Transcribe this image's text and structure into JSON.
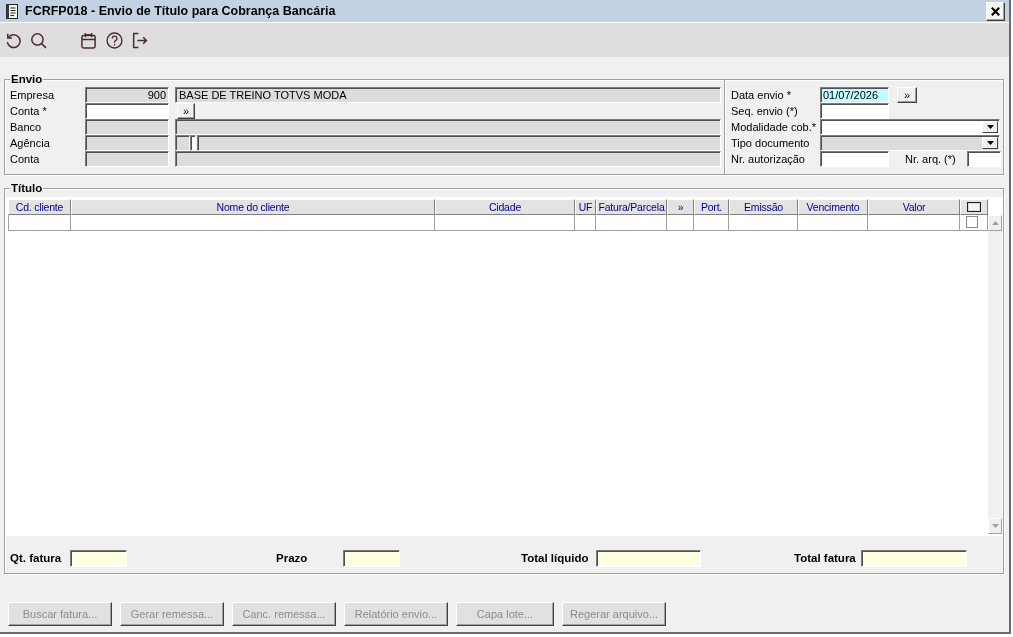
{
  "window": {
    "title": "FCRFP018 - Envio de Título para Cobrança Bancária"
  },
  "envio": {
    "title": "Envio",
    "left_rows": [
      {
        "label": "Empresa",
        "fields": [
          {
            "kind": "code",
            "value": "900",
            "disabled": true
          },
          {
            "kind": "name",
            "value": "BASE DE TREINO TOTVS MODA",
            "disabled": true
          }
        ]
      },
      {
        "label": "Conta *",
        "fields": [
          {
            "kind": "code",
            "disabled": false
          },
          {
            "kind": "lookup",
            "label": "»"
          }
        ]
      },
      {
        "label": "Banco",
        "fields": [
          {
            "kind": "code",
            "disabled": true
          },
          {
            "kind": "name",
            "disabled": true
          }
        ]
      },
      {
        "label": "Agência",
        "fields": [
          {
            "kind": "code",
            "disabled": true
          },
          {
            "kind": "digit",
            "disabled": true
          },
          {
            "kind": "mini",
            "disabled": false
          },
          {
            "kind": "name",
            "disabled": true
          }
        ]
      },
      {
        "label": "Conta",
        "fields": [
          {
            "kind": "code",
            "disabled": true
          },
          {
            "kind": "name",
            "disabled": true
          }
        ]
      }
    ],
    "right_rows": [
      {
        "label": "Data envio *",
        "field": {
          "kind": "date",
          "value": "01/07/2026",
          "disabled": false,
          "focused": true
        },
        "button": {
          "label": "»"
        }
      },
      {
        "label": "Seq. envio (*)",
        "field": {
          "kind": "short",
          "disabled": false,
          "focused": false
        }
      },
      {
        "label": "Modalidade cob.*",
        "field": {
          "kind": "combo",
          "disabled": false,
          "focused": false
        }
      },
      {
        "label": "Tipo documento",
        "field": {
          "kind": "combo",
          "disabled": true,
          "focused": false
        }
      },
      {
        "label": "Nr. autorização",
        "field": {
          "kind": "short",
          "disabled": false,
          "focused": false
        },
        "extra": {
          "label": "Nr. arq. (*)",
          "disabled": false
        }
      }
    ]
  },
  "titulo": {
    "title": "Título",
    "columns": [
      "Cd. cliente",
      "Nome do cliente",
      "Cidade",
      "UF",
      "Fatura/Parcela",
      "»",
      "Port.",
      "Emissão",
      "Vencimento",
      "Valor"
    ],
    "rows": [
      {
        "checked": false
      }
    ],
    "totals": [
      {
        "label": "Qt. fatura"
      },
      {
        "label": "Prazo"
      },
      {
        "label": "Total líquido"
      },
      {
        "label": "Total fatura"
      }
    ]
  },
  "buttons": [
    {
      "label": "Buscar fatura...",
      "disabled": true
    },
    {
      "label": "Gerar remessa...",
      "disabled": true
    },
    {
      "label": "Canc. remessa...",
      "disabled": true
    },
    {
      "label": "Relatório envio...",
      "disabled": true
    },
    {
      "label": "Capa lote...",
      "disabled": true
    },
    {
      "label": "Regerar arquivo...",
      "disabled": true
    }
  ]
}
